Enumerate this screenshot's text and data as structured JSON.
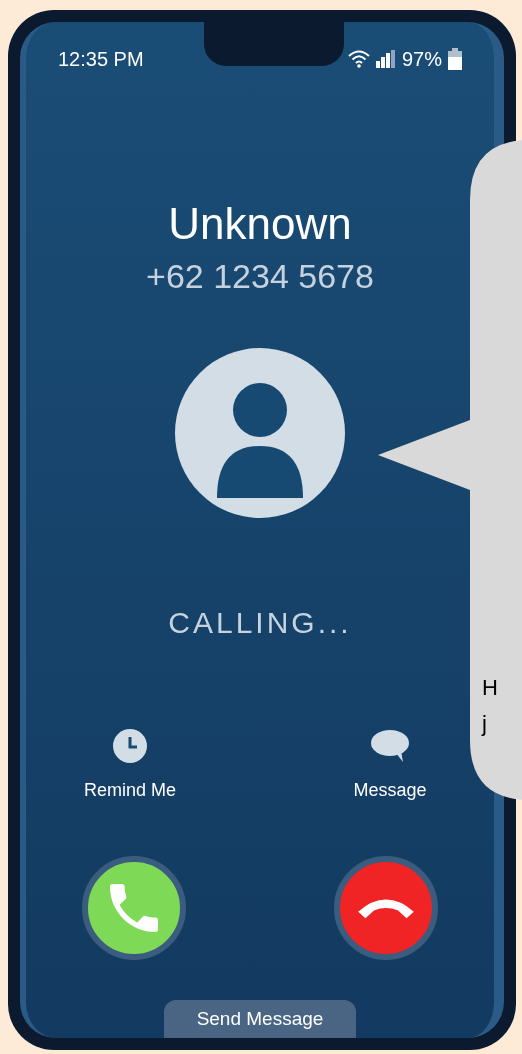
{
  "status_bar": {
    "time": "12:35 PM",
    "battery": "97%"
  },
  "caller": {
    "name": "Unknown",
    "number": "+62 1234 5678"
  },
  "call_status": "CALLING...",
  "actions": [
    {
      "kind": "clock",
      "label": "Remind Me"
    },
    {
      "kind": "chat",
      "label": "Message"
    }
  ],
  "call_buttons": [
    {
      "kind": "answer"
    },
    {
      "kind": "decline"
    }
  ],
  "bottom_tab": "Send Message",
  "speech_bubble": {
    "lines": [
      "H",
      "j"
    ]
  }
}
